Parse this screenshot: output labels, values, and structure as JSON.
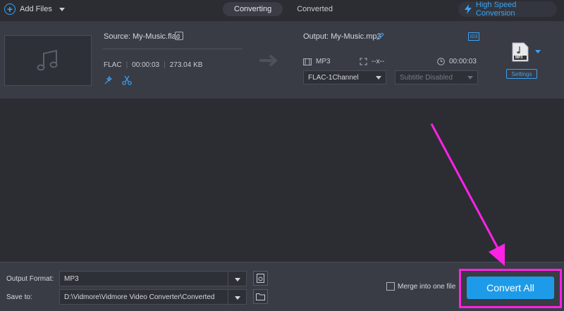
{
  "toolbar": {
    "add_files_label": "Add Files",
    "tabs": [
      {
        "label": "Converting",
        "active": true
      },
      {
        "label": "Converted",
        "active": false
      }
    ],
    "high_speed_label": "High Speed Conversion"
  },
  "file": {
    "source_label": "Source: My-Music.flac",
    "format": "FLAC",
    "duration": "00:00:03",
    "size": "273.04 KB",
    "output_label": "Output: My-Music.mp3",
    "id3_label": "ID3",
    "out_format": "MP3",
    "out_resolution": "--x--",
    "out_duration": "00:00:03",
    "audio_channel": "FLAC-1Channel",
    "subtitle": "Subtitle Disabled",
    "format_badge": "MP3",
    "settings_label": "Settings"
  },
  "bottom": {
    "output_format_label": "Output Format:",
    "output_format_value": "MP3",
    "save_to_label": "Save to:",
    "save_to_value": "D:\\Vidmore\\Vidmore Video Converter\\Converted",
    "merge_label": "Merge into one file",
    "merge_checked": false,
    "convert_all_label": "Convert All"
  },
  "colors": {
    "accent": "#1e9be8",
    "annotation": "#ff22e6",
    "panel": "#393c44",
    "background": "#2b2d33"
  }
}
